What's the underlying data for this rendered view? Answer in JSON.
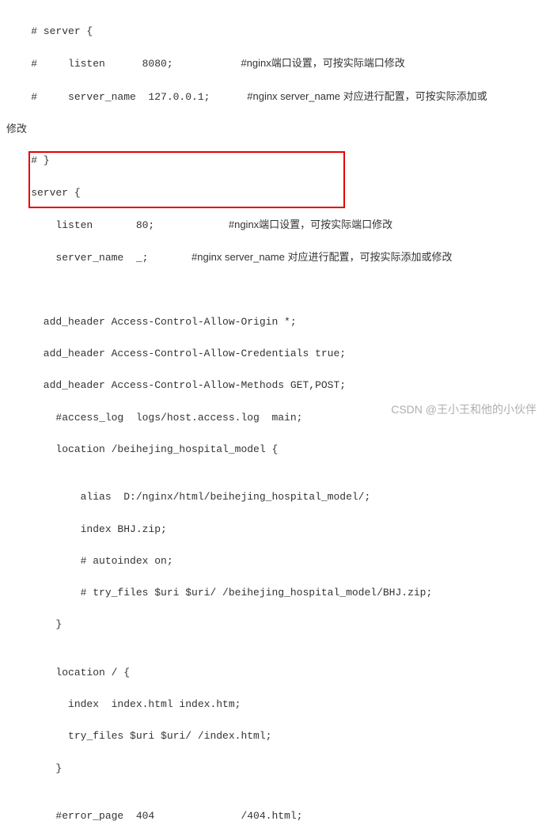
{
  "code": {
    "l1": "    # server {",
    "l2a": "    #     listen      8080;           ",
    "l2b": "#nginx端口设置，可按实际端口修改",
    "l3a": "    #     server_name  127.0.0.1;      ",
    "l3b": "#nginx server_name 对应进行配置，可按实际添加或",
    "l4": "修改",
    "l5": "    # }",
    "l6": "    server {",
    "l7a": "        listen       80;            ",
    "l7b": "#nginx端口设置，可按实际端口修改",
    "l8a": "        server_name  _;       ",
    "l8b": "#nginx server_name 对应进行配置，可按实际添加或修改",
    "l9": "",
    "l10": "",
    "l11": "      add_header Access-Control-Allow-Origin *;",
    "l12": "      add_header Access-Control-Allow-Credentials true;",
    "l13": "      add_header Access-Control-Allow-Methods GET,POST;",
    "l14": "        #access_log  logs/host.access.log  main;",
    "l15": "        location /beihejing_hospital_model {",
    "l16": "",
    "l17": "            alias  D:/nginx/html/beihejing_hospital_model/;",
    "l18": "            index BHJ.zip;",
    "l19": "            # autoindex on;",
    "l20": "            # try_files $uri $uri/ /beihejing_hospital_model/BHJ.zip;",
    "l21": "        }",
    "l22": "",
    "l23": "        location / {",
    "l24": "          index  index.html index.htm;",
    "l25": "          try_files $uri $uri/ /index.html;",
    "l26": "        }",
    "l27": "",
    "l28": "        #error_page  404              /404.html;"
  },
  "watermark": "CSDN @王小王和他的小伙伴"
}
